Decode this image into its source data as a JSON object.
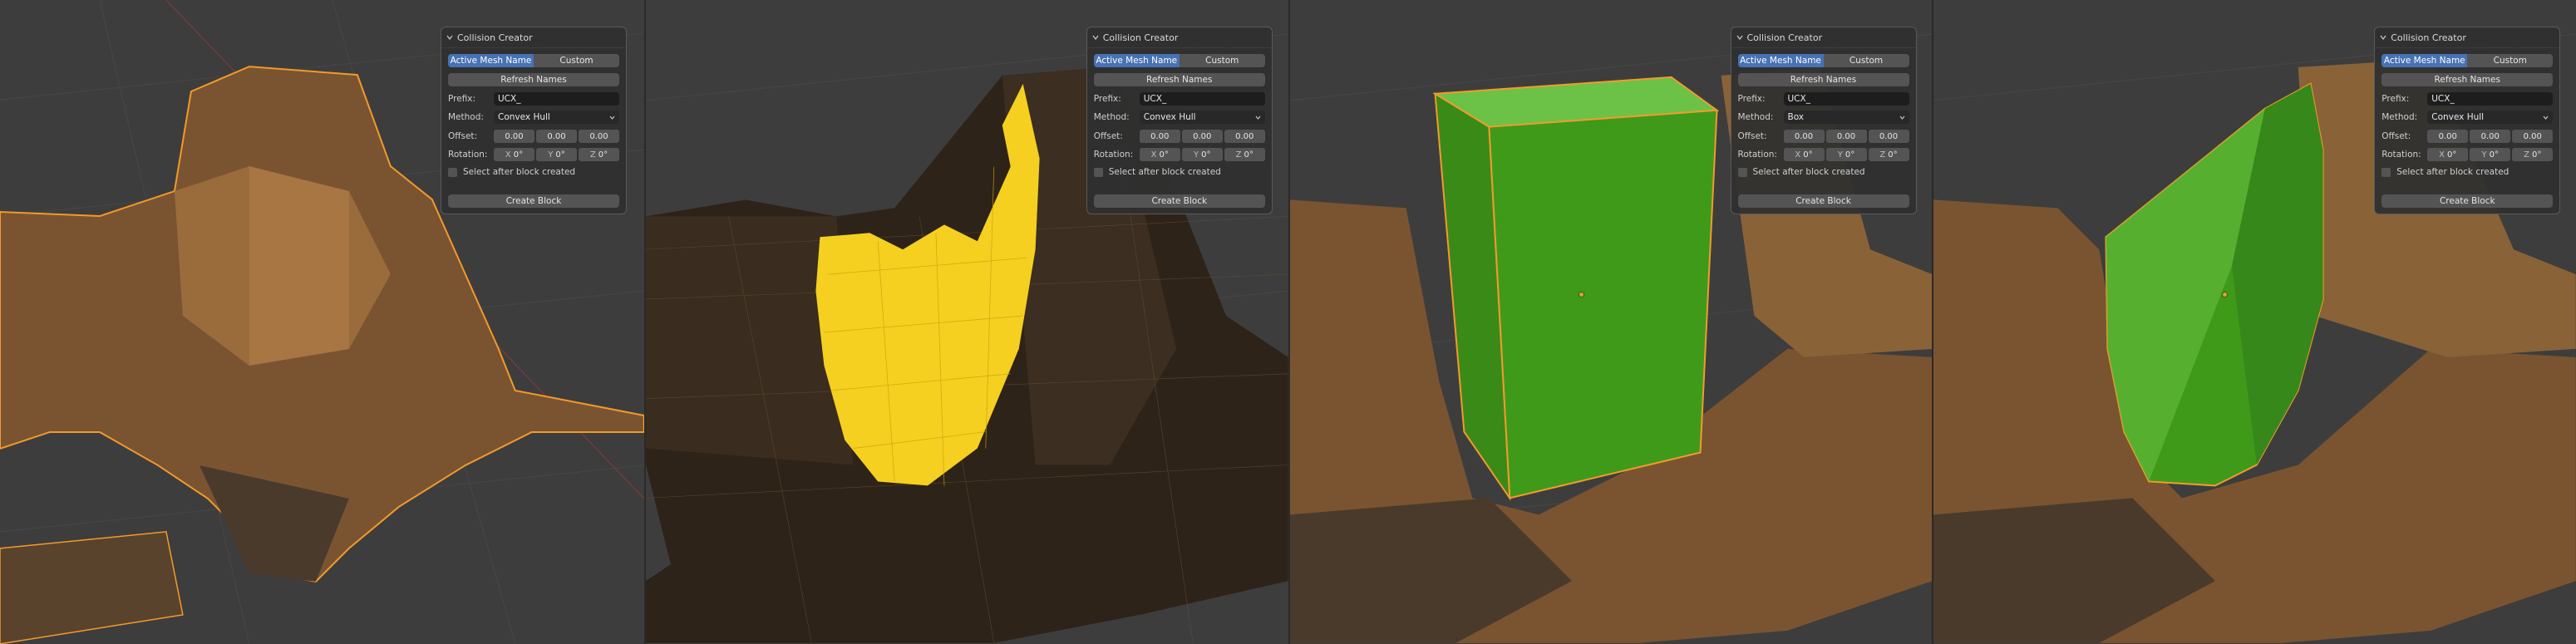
{
  "panels": [
    {
      "title": "Collision Creator",
      "mode_active": "Active Mesh Name",
      "mode_custom": "Custom",
      "refresh": "Refresh Names",
      "prefix_label": "Prefix:",
      "prefix_value": "UCX_",
      "method_label": "Method:",
      "method_value": "Convex Hull",
      "offset_label": "Offset:",
      "offset_values": [
        "0.00",
        "0.00",
        "0.00"
      ],
      "rotation_label": "Rotation:",
      "rot_axes": [
        "X",
        "Y",
        "Z"
      ],
      "rotation_values": [
        "0°",
        "0°",
        "0°"
      ],
      "select_after": "Select after block created",
      "create": "Create Block"
    },
    {
      "title": "Collision Creator",
      "mode_active": "Active Mesh Name",
      "mode_custom": "Custom",
      "refresh": "Refresh Names",
      "prefix_label": "Prefix:",
      "prefix_value": "UCX_",
      "method_label": "Method:",
      "method_value": "Convex Hull",
      "offset_label": "Offset:",
      "offset_values": [
        "0.00",
        "0.00",
        "0.00"
      ],
      "rotation_label": "Rotation:",
      "rot_axes": [
        "X",
        "Y",
        "Z"
      ],
      "rotation_values": [
        "0°",
        "0°",
        "0°"
      ],
      "select_after": "Select after block created",
      "create": "Create Block"
    },
    {
      "title": "Collision Creator",
      "mode_active": "Active Mesh Name",
      "mode_custom": "Custom",
      "refresh": "Refresh Names",
      "prefix_label": "Prefix:",
      "prefix_value": "UCX_",
      "method_label": "Method:",
      "method_value": "Box",
      "offset_label": "Offset:",
      "offset_values": [
        "0.00",
        "0.00",
        "0.00"
      ],
      "rotation_label": "Rotation:",
      "rot_axes": [
        "X",
        "Y",
        "Z"
      ],
      "rotation_values": [
        "0°",
        "0°",
        "0°"
      ],
      "select_after": "Select after block created",
      "create": "Create Block"
    },
    {
      "title": "Collision Creator",
      "mode_active": "Active Mesh Name",
      "mode_custom": "Custom",
      "refresh": "Refresh Names",
      "prefix_label": "Prefix:",
      "prefix_value": "UCX_",
      "method_label": "Method:",
      "method_value": "Convex Hull",
      "offset_label": "Offset:",
      "offset_values": [
        "0.00",
        "0.00",
        "0.00"
      ],
      "rotation_label": "Rotation:",
      "rot_axes": [
        "X",
        "Y",
        "Z"
      ],
      "rotation_values": [
        "0°",
        "0°",
        "0°"
      ],
      "select_after": "Select after block created",
      "create": "Create Block"
    }
  ],
  "colors": {
    "viewport_bg": "#3d3d3d",
    "selection_outline": "#f39a2b",
    "wireframe_highlight": "#f5d020",
    "collision_green": "#3f9a1a",
    "active_tab": "#4772b3"
  }
}
